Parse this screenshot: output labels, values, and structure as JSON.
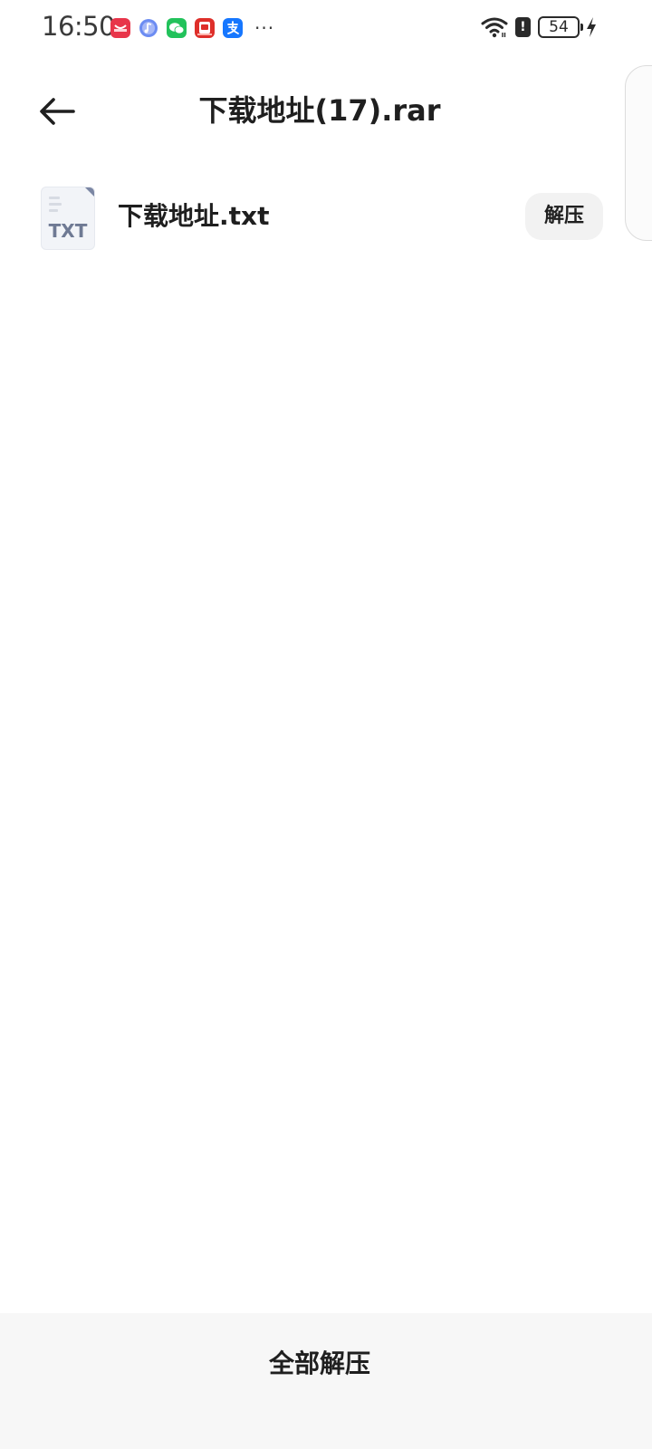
{
  "status_bar": {
    "time": "16:50",
    "notification_icons": [
      {
        "name": "red-app-icon",
        "color": "#e8354a"
      },
      {
        "name": "music-app-icon",
        "color": "#5b7cf0"
      },
      {
        "name": "wechat-icon",
        "color": "#22c25b"
      },
      {
        "name": "red-badge-app-icon",
        "color": "#de2f2a"
      },
      {
        "name": "alipay-icon",
        "color": "#1677ff"
      }
    ],
    "more": "···",
    "alert": "!",
    "battery_level": "54"
  },
  "header": {
    "title": "下载地址(17).rar"
  },
  "files": [
    {
      "type_label": "TXT",
      "name": "下载地址.txt",
      "action_label": "解压"
    }
  ],
  "bottom": {
    "extract_all_label": "全部解压"
  },
  "colors": {
    "text_primary": "#1f1f1f",
    "button_bg": "#f2f2f2",
    "bottom_bar_bg": "#f7f7f7",
    "file_icon_accent": "#7b86a3"
  }
}
